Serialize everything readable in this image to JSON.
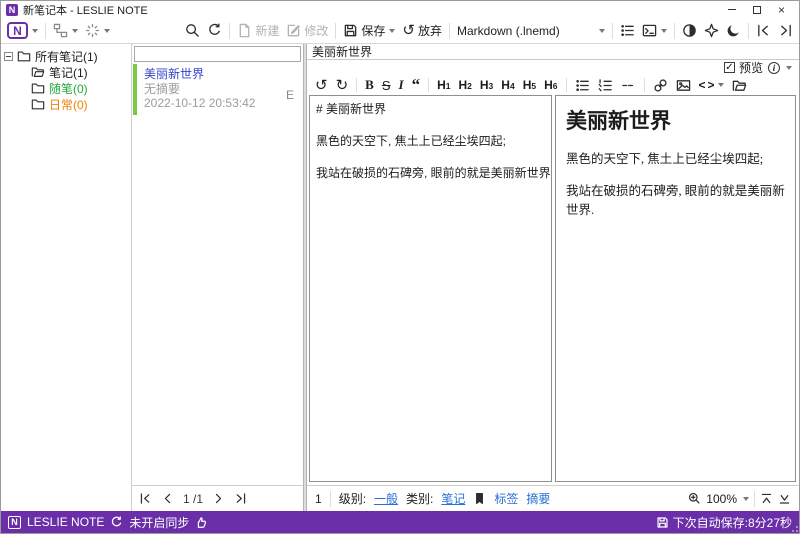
{
  "colors": {
    "brand_purple": "#6A2FA8",
    "link_blue": "#2970D6",
    "note_title_blue": "#3344CC",
    "folder_green": "#27A83C",
    "folder_orange": "#F08200",
    "note_accent_green": "#7AC943"
  },
  "titlebar": {
    "logo": "N",
    "title": "新笔记本 - LESLIE NOTE"
  },
  "toolbar": {
    "app_logo": "N",
    "new_label": "新建",
    "modify_label": "修改",
    "save_label": "保存",
    "discard_label": "放弃",
    "format_selector": "Markdown  (.lnemd)"
  },
  "sidebar": {
    "items": [
      {
        "label": "所有笔记(1)"
      },
      {
        "label": "笔记(1)"
      },
      {
        "label": "随笔(0)"
      },
      {
        "label": "日常(0)"
      }
    ]
  },
  "notelist": {
    "items": [
      {
        "title": "美丽新世界",
        "summary": "无摘要",
        "date": "2022-10-12 20:53:42",
        "flag": "E"
      }
    ],
    "pagination": {
      "current": "1",
      "total": "/1"
    }
  },
  "editor": {
    "title": "美丽新世界",
    "preview_label": "预览",
    "md_toolbar": {
      "undo": "↺",
      "redo": "↻",
      "bold": "B",
      "strike": "S",
      "italic": "I",
      "quote": "“",
      "headings": [
        {
          "h": "H",
          "n": "1"
        },
        {
          "h": "H",
          "n": "2"
        },
        {
          "h": "H",
          "n": "3"
        },
        {
          "h": "H",
          "n": "4"
        },
        {
          "h": "H",
          "n": "5"
        },
        {
          "h": "H",
          "n": "6"
        }
      ],
      "code_open": "<",
      "code_close": ">"
    },
    "source_lines": [
      "# 美丽新世界",
      "",
      "黑色的天空下, 焦土上已经尘埃四起;",
      "",
      "我站在破损的石碑旁, 眼前的就是美丽新世界."
    ],
    "preview": {
      "heading": "美丽新世界",
      "paragraphs": [
        "黑色的天空下, 焦土上已经尘埃四起;",
        "我站在破损的石碑旁, 眼前的就是美丽新世界."
      ]
    },
    "meta": {
      "indicator": "1",
      "level_label": "级别:",
      "level_value": "一般",
      "category_label": "类别:",
      "category_value": "笔记",
      "tags_label": "标签",
      "summary_label": "摘要",
      "zoom_value": "100%"
    }
  },
  "statusbar": {
    "logo": "N",
    "app_name": "LESLIE NOTE",
    "sync_status": "未开启同步",
    "autosave": "下次自动保存:8分27秒"
  }
}
